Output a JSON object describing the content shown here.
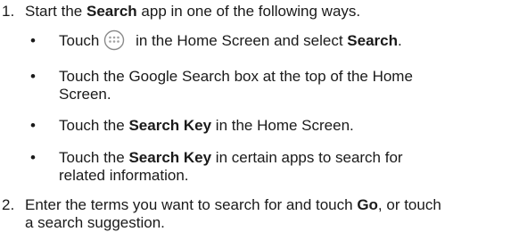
{
  "steps": [
    {
      "number": "1.",
      "parts": [
        "Start the ",
        "Search",
        " app in one of the following ways."
      ],
      "bullets": [
        {
          "dot": "•",
          "before": "Touch",
          "icon": "apps-grid-icon",
          "after": " in the Home Screen and select ",
          "bold": "Search",
          "end": "."
        },
        {
          "dot": "•",
          "line1": "Touch the Google Search box at the top of the Home",
          "line2": "Screen."
        },
        {
          "dot": "•",
          "before": "Touch the ",
          "bold": "Search Key",
          "after": " in the Home Screen."
        },
        {
          "dot": "•",
          "before": "Touch the ",
          "bold": "Search Key",
          "after": " in certain apps to search for",
          "line2": "related information."
        }
      ]
    },
    {
      "number": "2.",
      "parts": [
        "Enter the terms you want to search for and touch ",
        "Go",
        ", or touch"
      ],
      "line2": "a search suggestion."
    }
  ],
  "colors": {
    "text": "#1a1a1a",
    "icon_stroke": "#8a8a8a",
    "icon_dots": "#a0a0a0"
  }
}
